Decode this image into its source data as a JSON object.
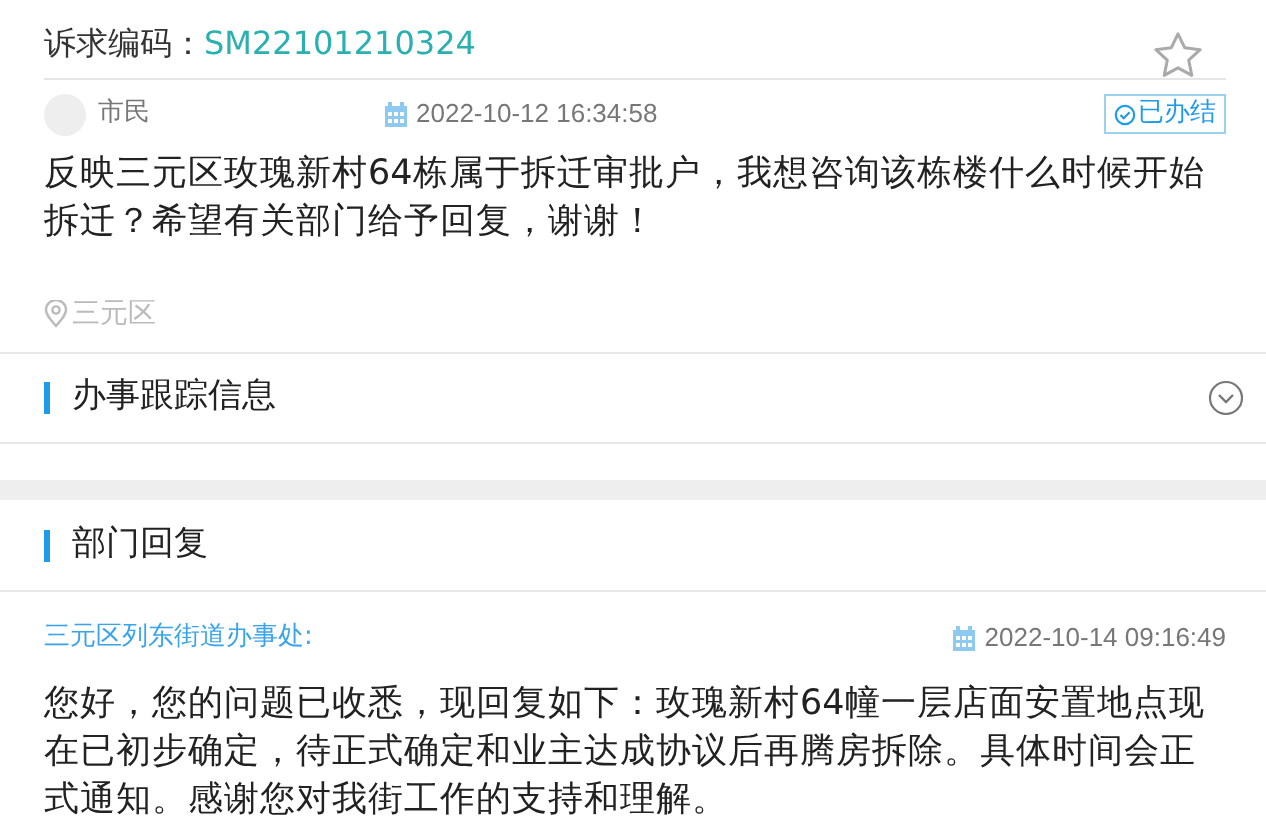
{
  "header": {
    "label": "诉求编码：",
    "code": "SM22101210324",
    "starred": false
  },
  "post": {
    "author": "市民",
    "time": "2022-10-12 16:34:58",
    "status": "已办结",
    "content": "反映三元区玫瑰新村64栋属于拆迁审批户，我想咨询该栋楼什么时候开始拆迁？希望有关部门给予回复，谢谢！",
    "location": "三元区"
  },
  "tracking": {
    "title": "办事跟踪信息",
    "expanded": false
  },
  "reply": {
    "title": "部门回复",
    "department": "三元区列东街道办事处:",
    "time": "2022-10-14 09:16:49",
    "content": "您好，您的问题已收悉，现回复如下：玫瑰新村64幢一层店面安置地点现在已初步确定，待正式确定和业主达成协议后再腾房拆除。具体时间会正式通知。感谢您对我街工作的支持和理解。"
  }
}
